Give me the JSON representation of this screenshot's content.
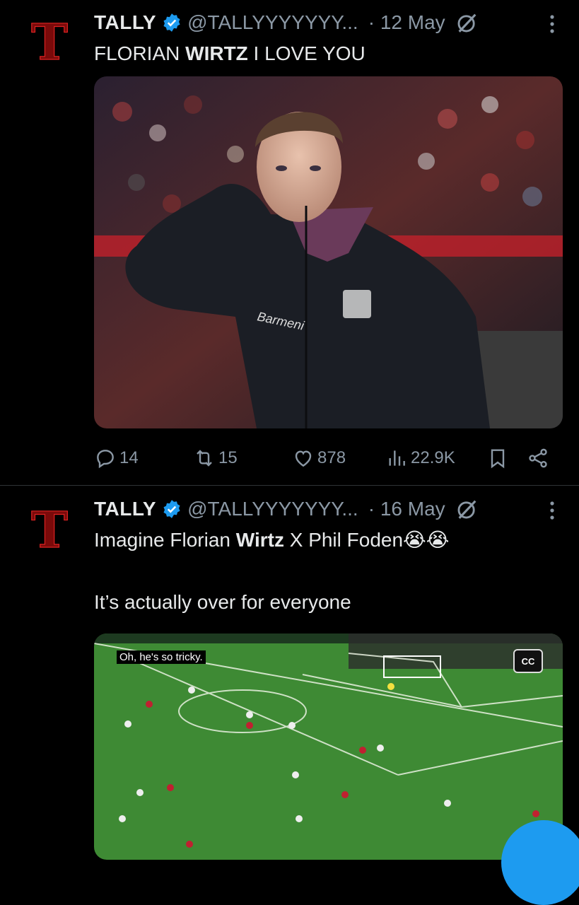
{
  "tweets": [
    {
      "author_name": "TALLY",
      "handle": "@TALLYYYYYYY...",
      "date": "· 12 May",
      "text_parts": [
        "FLORIAN ",
        "WIRTZ",
        " I LOVE YOU"
      ],
      "stats": {
        "replies": "14",
        "retweets": "15",
        "likes": "878",
        "views": "22.9K"
      }
    },
    {
      "author_name": "TALLY",
      "handle": "@TALLYYYYYYY...",
      "date": "· 16 May",
      "text_line1_parts": [
        "Imagine Florian ",
        "Wirtz",
        " X Phil Foden😭😭"
      ],
      "text_line2": "It’s actually over for everyone",
      "video_caption": "Oh, he's so tricky.",
      "cc_label": "CC"
    }
  ],
  "colors": {
    "background": "#000000",
    "text": "#e7e9ea",
    "muted": "#8b98a5",
    "verified": "#1d9bf0",
    "avatar_red": "#8b0000"
  },
  "icons": [
    "verified-icon",
    "grok-icon",
    "more-icon",
    "reply-icon",
    "retweet-icon",
    "like-icon",
    "views-icon",
    "bookmark-icon",
    "share-icon"
  ]
}
